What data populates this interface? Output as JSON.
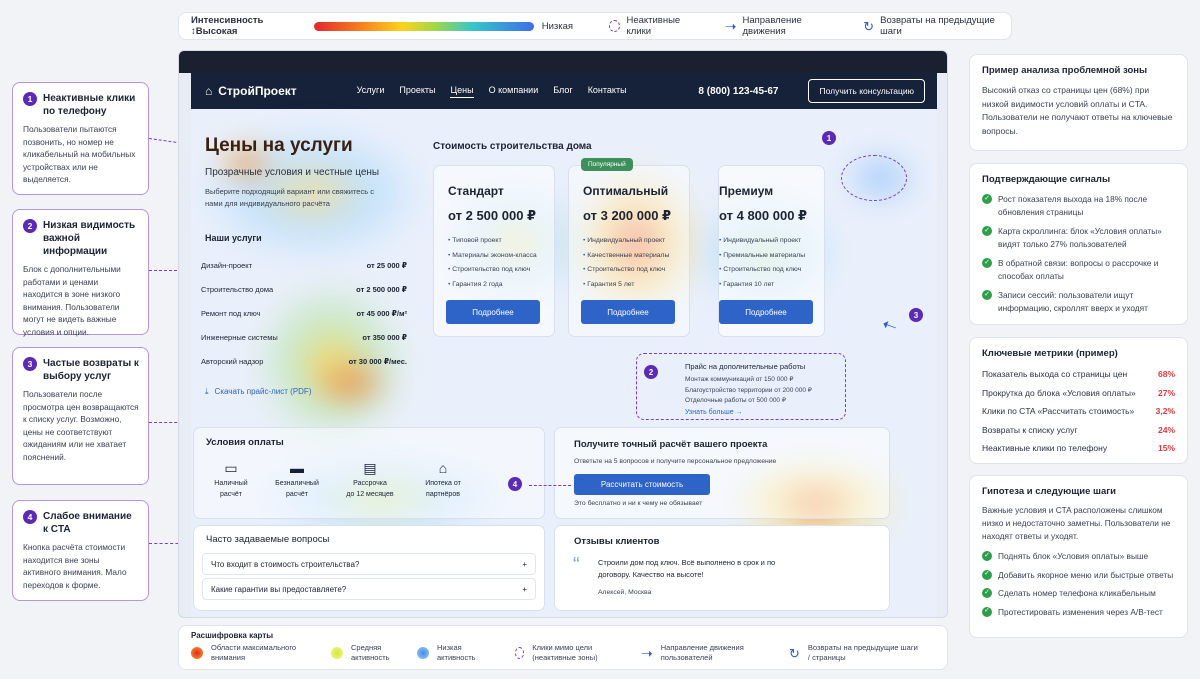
{
  "legend_top": {
    "intensity_label": "Интенсивность ↕Высокая",
    "low_label": "Низкая",
    "inactive_clicks": "Неактивные клики",
    "movement": "Направление движения",
    "returns": "Возвраты на предыдущие шаги"
  },
  "notes": [
    {
      "num": "1",
      "title": "Неактивные клики по телефону",
      "body": "Пользователи пытаются позвонить, но номер не кликабельный на мобильных устройствах или не выделяется."
    },
    {
      "num": "2",
      "title": "Низкая видимость важной информации",
      "body": "Блок с дополнительными работами и ценами находится в зоне низкого внимания. Пользователи могут не видеть важные условия и опции."
    },
    {
      "num": "3",
      "title": "Частые возвраты к выбору услуг",
      "body": "Пользователи после просмотра цен возвращаются к списку услуг. Возможно, цены не соответствуют ожиданиям или не хватает пояснений."
    },
    {
      "num": "4",
      "title": "Слабое внимание к CTA",
      "body": "Кнопка расчёта стоимости находится вне зоны активного внимания. Мало переходов к форме."
    }
  ],
  "site": {
    "logo": "СтройПроект",
    "menu": [
      "Услуги",
      "Проекты",
      "Цены",
      "О компании",
      "Блог",
      "Контакты"
    ],
    "phone": "8 (800) 123-45-67",
    "cta": "Получить консультацию",
    "hero_title": "Цены на услуги",
    "hero_subtitle": "Прозрачные условия и честные цены",
    "hero_text": "Выберите подходящий вариант или свяжитесь с нами для индивидуального расчёта",
    "services_title": "Наши услуги",
    "services": [
      {
        "name": "Дизайн-проект",
        "price": "от 25 000 ₽"
      },
      {
        "name": "Строительство дома",
        "price": "от 2 500 000 ₽"
      },
      {
        "name": "Ремонт под ключ",
        "price": "от 45 000 ₽/м²"
      },
      {
        "name": "Инженерные системы",
        "price": "от 350 000 ₽"
      },
      {
        "name": "Авторский надзор",
        "price": "от 30 000 ₽/мес."
      }
    ],
    "download": "Скачать прайс-лист (PDF)",
    "plans_title": "Стоимость строительства дома",
    "popular": "Популярный",
    "plans": [
      {
        "name": "Стандарт",
        "price": "от 2 500 000 ₽",
        "features": [
          "Типовой проект",
          "Материалы эконом-класса",
          "Строительство под ключ",
          "Гарантия 2 года"
        ],
        "button": "Подробнее"
      },
      {
        "name": "Оптимальный",
        "price": "от 3 200 000 ₽",
        "features": [
          "Индивидуальный проект",
          "Качественные материалы",
          "Строительство под ключ",
          "Гарантия 5 лет"
        ],
        "button": "Подробнее"
      },
      {
        "name": "Премиум",
        "price": "от 4 800 000 ₽",
        "features": [
          "Индивидуальный проект",
          "Премиальные материалы",
          "Строительство под ключ",
          "Гарантия 10 лет"
        ],
        "button": "Подробнее"
      }
    ],
    "extra": {
      "title": "Прайс на дополнительные работы",
      "rows": [
        "Монтаж коммуникаций от 150 000 ₽",
        "Благоустройство территории от 200 000 ₽",
        "Отделочные работы от 500 000 ₽"
      ],
      "link": "Узнать больше →"
    },
    "payment": {
      "title": "Условия оплаты",
      "items": [
        {
          "l1": "Наличный",
          "l2": "расчёт"
        },
        {
          "l1": "Безналичный",
          "l2": "расчёт"
        },
        {
          "l1": "Рассрочка",
          "l2": "до 12 месяцев"
        },
        {
          "l1": "Ипотека от",
          "l2": "партнёров"
        }
      ]
    },
    "calc": {
      "title": "Получите точный расчёт вашего проекта",
      "sub": "Ответьте на 5 вопросов и получите персональное предложение",
      "button": "Рассчитать стоимость",
      "foot": "Это бесплатно и ни к чему не обязывает"
    },
    "faq": {
      "title": "Часто задаваемые вопросы",
      "items": [
        "Что входит в стоимость строительства?",
        "Какие гарантии вы предоставляете?"
      ]
    },
    "reviews": {
      "title": "Отзывы клиентов",
      "text": "Строили дом под ключ. Всё выполнено в срок и по договору. Качество на высоте!",
      "author": "Алексей, Москва"
    }
  },
  "pins": [
    "1",
    "2",
    "3",
    "4"
  ],
  "panel": {
    "example_title": "Пример анализа проблемной зоны",
    "example_text": "Высокий отказ со страницы цен (68%) при низкой видимости условий оплаты и CTA. Пользователи не получают ответы на ключевые вопросы.",
    "signals_title": "Подтверждающие сигналы",
    "signals": [
      "Рост показателя выхода на 18% после обновления страницы",
      "Карта скроллинга: блок «Условия оплаты» видят только 27% пользователей",
      "В обратной связи: вопросы о рассрочке и способах оплаты",
      "Записи сессий: пользователи ищут информацию, скроллят вверх и уходят"
    ],
    "metrics_title": "Ключевые метрики (пример)",
    "metrics": [
      {
        "label": "Показатель выхода со страницы цен",
        "value": "68%"
      },
      {
        "label": "Прокрутка до блока «Условия оплаты»",
        "value": "27%"
      },
      {
        "label": "Клики по CTA «Рассчитать стоимость»",
        "value": "3,2%"
      },
      {
        "label": "Возвраты к списку услуг",
        "value": "24%"
      },
      {
        "label": "Неактивные клики по телефону",
        "value": "15%"
      }
    ],
    "hyp_title": "Гипотеза и следующие шаги",
    "hyp_text": "Важные условия и CTA расположены слишком низко и недостаточно заметны. Пользователи не находят ответы и уходят.",
    "steps": [
      "Поднять блок «Условия оплаты» выше",
      "Добавить якорное меню или быстрые ответы",
      "Сделать номер телефона кликабельным",
      "Протестировать изменения через A/B-тест"
    ]
  },
  "bottom_legend": {
    "title": "Расшифровка карты",
    "high": "Области максимального внимания",
    "mid": "Средняя активность",
    "low": "Низкая активность",
    "miss": "Клики мимо цели (неактивные зоны)",
    "dir": "Направление движения пользователей",
    "ret": "Возвраты на предыдущие шаги / страницы"
  },
  "colors": {
    "accent": "#2e63c8",
    "pin": "#5b2ab8",
    "alert": "#e0393e",
    "nav": "#16213a"
  }
}
